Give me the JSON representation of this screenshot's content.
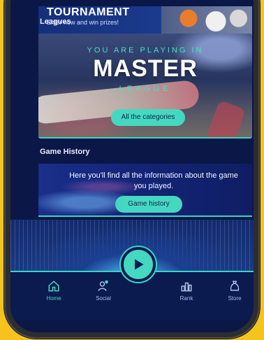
{
  "tournament": {
    "title": "TOURNAMENT",
    "subtitle": "Enter now and win prizes!"
  },
  "leagues": {
    "section_label": "Leagues",
    "banner_top": "YOU ARE PLAYING IN",
    "banner_main": "MASTER",
    "banner_bottom": "LEAGUE",
    "button_label": "All the categories"
  },
  "history": {
    "section_label": "Game History",
    "info_text": "Here you'll find all the information about the game you played.",
    "button_label": "Game history"
  },
  "nav": {
    "items": [
      {
        "label": "Home",
        "icon": "home-icon",
        "active": true
      },
      {
        "label": "Social",
        "icon": "social-icon",
        "active": false
      },
      {
        "label": "Rank",
        "icon": "rank-icon",
        "active": false
      },
      {
        "label": "Store",
        "icon": "store-icon",
        "active": false
      }
    ],
    "play_icon": "play-icon"
  },
  "colors": {
    "accent": "#45d8c1",
    "background": "#0a1747",
    "frame": "#f6c21c"
  }
}
